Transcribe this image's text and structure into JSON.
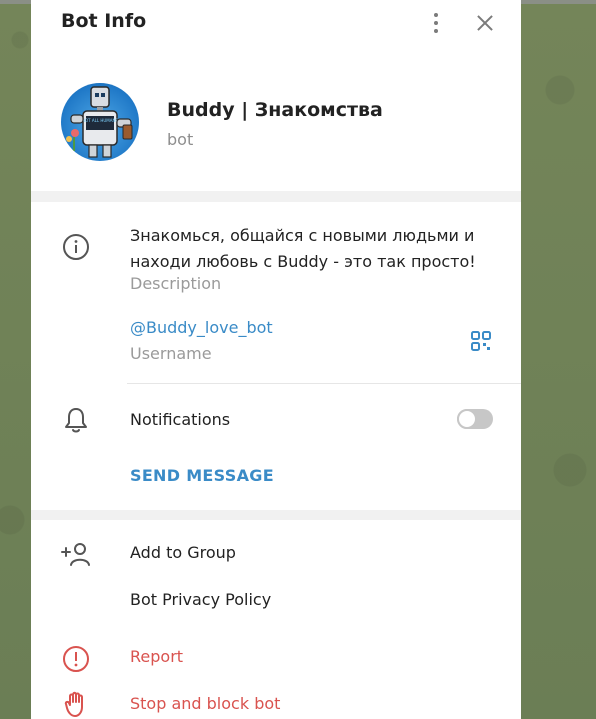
{
  "header": {
    "title": "Bot Info"
  },
  "profile": {
    "name": "Buddy | Знакомства",
    "subtitle": "bot"
  },
  "info": {
    "description": "Знакомься, общайся с новыми людьми и находи любовь с Buddy - это так просто!",
    "description_label": "Description",
    "username": "@Buddy_love_bot",
    "username_label": "Username"
  },
  "notifications": {
    "label": "Notifications",
    "enabled": false
  },
  "send_message": {
    "label": "SEND MESSAGE"
  },
  "actions": {
    "add_to_group": "Add to Group",
    "privacy_policy": "Bot Privacy Policy",
    "report": "Report",
    "stop_block": "Stop and block bot"
  },
  "colors": {
    "accent": "#3a8bc7",
    "danger": "#d9534f",
    "background": "#6f8159"
  },
  "avatar": {
    "text": "NOT ALL HUMANS"
  }
}
